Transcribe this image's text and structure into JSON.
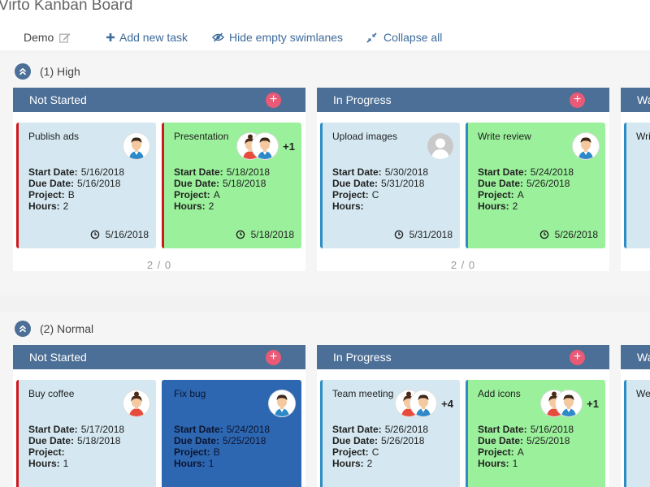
{
  "app": {
    "title": "Virto Kanban Board"
  },
  "toolbar": {
    "view_name": "Demo",
    "add_task": "Add new task",
    "hide_empty": "Hide empty swimlanes",
    "collapse_all": "Collapse all"
  },
  "colors": {
    "header": "#4c6f97",
    "add": "#e85a75",
    "green": "#9bf09b",
    "light_blue": "#d5e8f1",
    "dark_blue": "#2e67b1",
    "red": "#d0181b",
    "blue": "#2b8dc4"
  },
  "field_labels": {
    "start": "Start Date:",
    "due": "Due Date:",
    "project": "Project:",
    "hours": "Hours:"
  },
  "swimlanes": [
    {
      "label": "(1) High",
      "columns": [
        {
          "title": "Not Started",
          "add": "+",
          "count": "2 / 0",
          "cards": [
            {
              "title": "Publish ads",
              "start": "5/16/2018",
              "due": "5/16/2018",
              "project": "B",
              "hours": "2",
              "date": "5/16/2018"
            },
            {
              "title": "Presentation",
              "start": "5/18/2018",
              "due": "5/18/2018",
              "project": "A",
              "hours": "2",
              "date": "5/18/2018",
              "extra": "+1"
            }
          ]
        },
        {
          "title": "In Progress",
          "add": "+",
          "count": "2 / 0",
          "cards": [
            {
              "title": "Upload images",
              "start": "5/30/2018",
              "due": "5/31/2018",
              "project": "C",
              "hours": "",
              "date": "5/31/2018"
            },
            {
              "title": "Write review",
              "start": "5/24/2018",
              "due": "5/26/2018",
              "project": "A",
              "hours": "2",
              "date": "5/26/2018"
            }
          ]
        },
        {
          "title": "Wa",
          "cards": [
            {
              "title": "Wri"
            }
          ]
        }
      ]
    },
    {
      "label": "(2) Normal",
      "columns": [
        {
          "title": "Not Started",
          "add": "+",
          "cards": [
            {
              "title": "Buy coffee",
              "start": "5/17/2018",
              "due": "5/18/2018",
              "project": "",
              "hours": "1"
            },
            {
              "title": "Fix bug",
              "start": "5/24/2018",
              "due": "5/25/2018",
              "project": "B",
              "hours": "1"
            }
          ]
        },
        {
          "title": "In Progress",
          "add": "+",
          "cards": [
            {
              "title": "Team meeting",
              "start": "5/26/2018",
              "due": "5/26/2018",
              "project": "C",
              "hours": "2",
              "extra": "+4"
            },
            {
              "title": "Add icons",
              "start": "5/16/2018",
              "due": "5/25/2018",
              "project": "A",
              "hours": "1",
              "extra": "+1"
            }
          ]
        },
        {
          "title": "Wa",
          "cards": [
            {
              "title": "We"
            }
          ]
        }
      ]
    }
  ]
}
